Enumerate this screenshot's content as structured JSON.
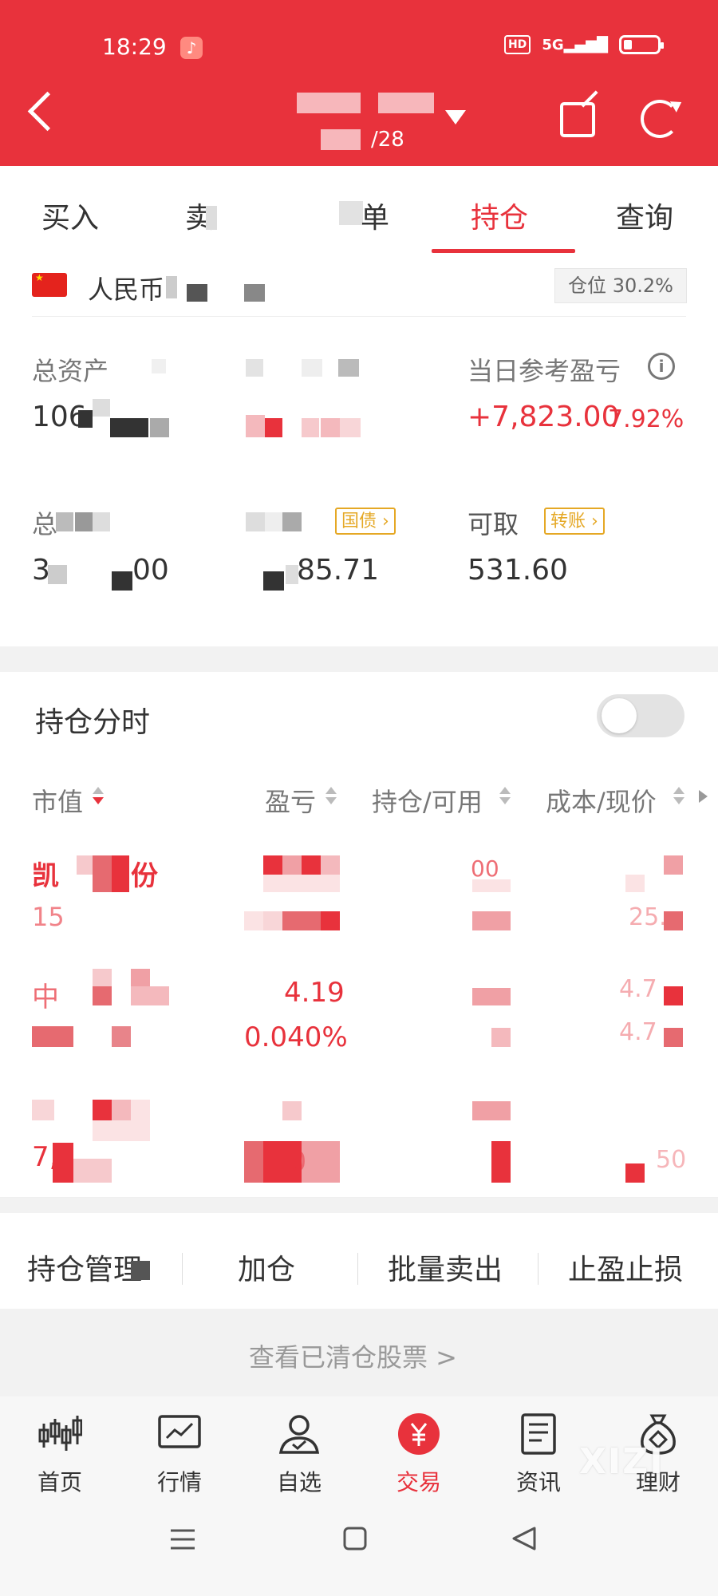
{
  "status_bar": {
    "time": "18:29",
    "hd": "HD",
    "network": "5G"
  },
  "header": {
    "subtitle": "/28"
  },
  "tabs": [
    {
      "label": "买入"
    },
    {
      "label": "卖"
    },
    {
      "label": "单"
    },
    {
      "label": "持仓"
    },
    {
      "label": "查询"
    }
  ],
  "account": {
    "currency_label": "人民币",
    "position_badge": "仓位 30.2%",
    "total_assets_label": "总资产",
    "total_assets_value": "106",
    "daily_pnl_label": "当日参考盈亏",
    "daily_pnl_value": "+7,823.00",
    "daily_pnl_pct": "7.92%",
    "total2_label": "总",
    "total2_value": "3",
    "total2_value_tail": "00",
    "col2_value_tail": "85.71",
    "bond_tag": "国债",
    "withdrawable_label": "可取",
    "transfer_tag": "转账",
    "withdrawable_value": "531.60"
  },
  "holding_time": {
    "label": "持仓分时",
    "enabled": false
  },
  "columns": [
    {
      "label": "市值"
    },
    {
      "label": "盈亏"
    },
    {
      "label": "持仓/可用"
    },
    {
      "label": "成本/现价"
    }
  ],
  "rows": [
    {
      "name": "凯",
      "name_tail": "份",
      "market_value": "15",
      "position": "00",
      "cost_now": "25."
    },
    {
      "name": "中",
      "pnl": "4.19",
      "pnl_pct": "0.040%",
      "cost": "4.7",
      "now": "4.7"
    },
    {
      "name": "",
      "market_value": "7,",
      "pnl_pct": "1.0",
      "now": "50"
    }
  ],
  "actions": [
    {
      "label": "持仓管理"
    },
    {
      "label": "加仓"
    },
    {
      "label": "批量卖出"
    },
    {
      "label": "止盈止损"
    }
  ],
  "cleared_link": "查看已清仓股票 >",
  "nav": [
    {
      "label": "首页",
      "icon": "candlestick-icon"
    },
    {
      "label": "行情",
      "icon": "chart-icon"
    },
    {
      "label": "自选",
      "icon": "user-icon"
    },
    {
      "label": "交易",
      "icon": "yuan-icon"
    },
    {
      "label": "资讯",
      "icon": "document-icon"
    },
    {
      "label": "理财",
      "icon": "moneybag-icon"
    }
  ],
  "watermark": "XIZI",
  "colors": {
    "brand_red": "#e8323c",
    "gold": "#e5a825"
  }
}
